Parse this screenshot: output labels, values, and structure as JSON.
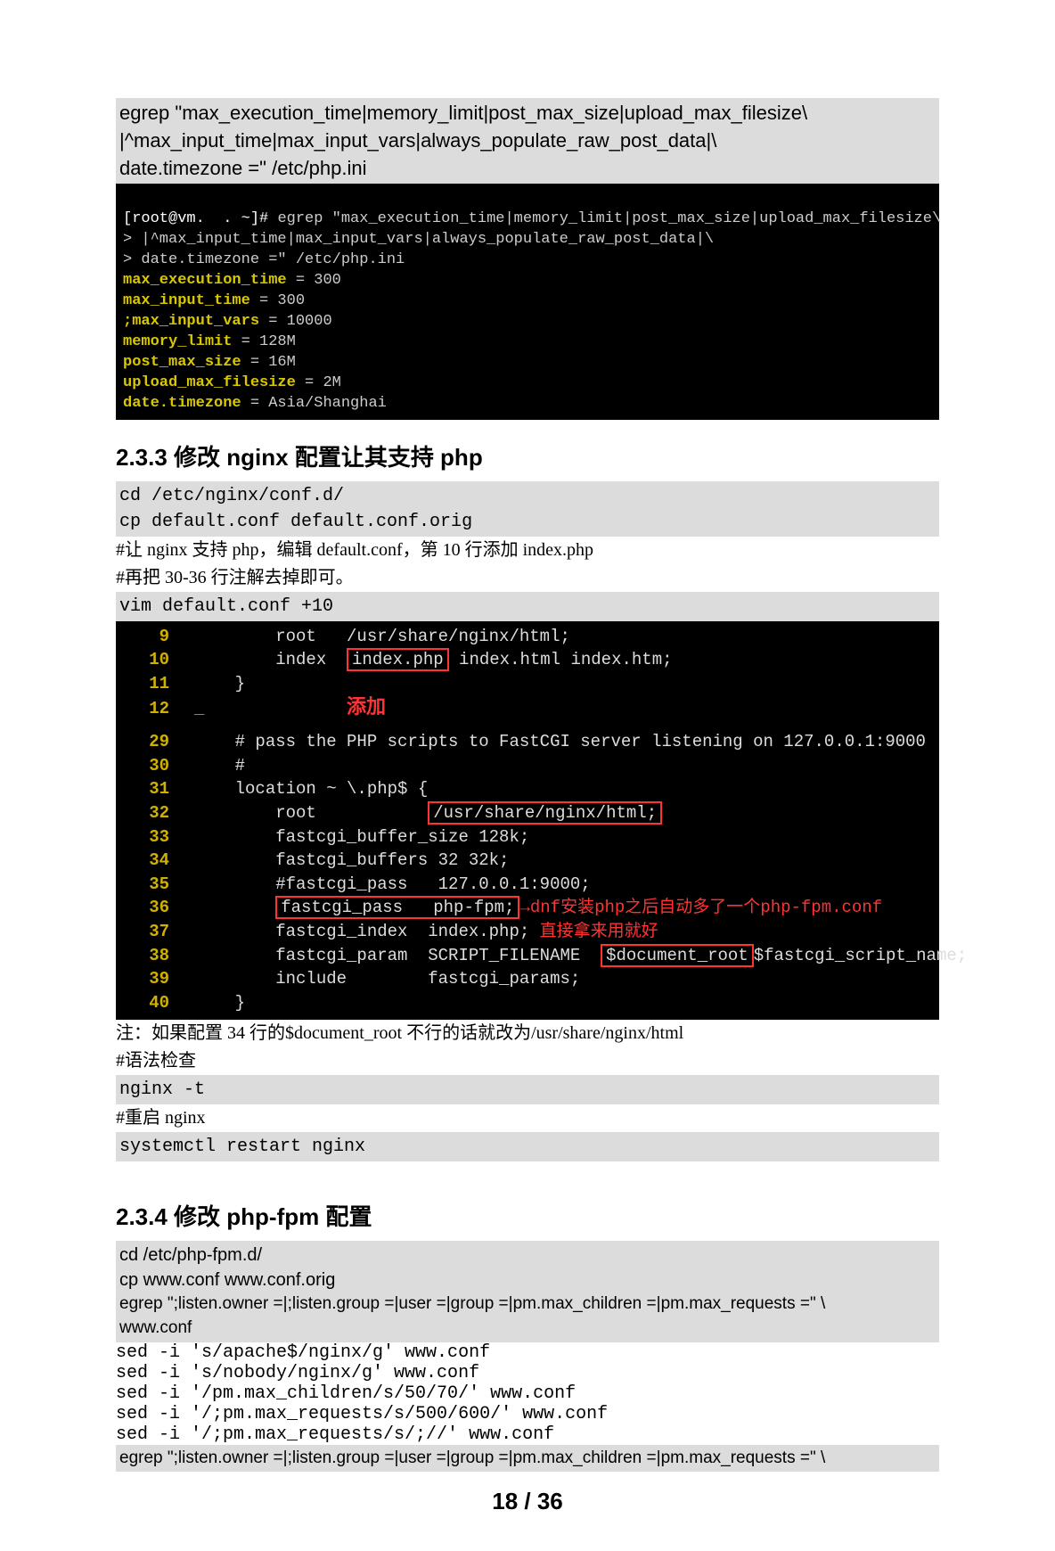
{
  "block1": {
    "l1": "egrep \"max_execution_time|memory_limit|post_max_size|upload_max_filesize\\",
    "l2": "|^max_input_time|max_input_vars|always_populate_raw_post_data|\\",
    "l3": "date.timezone =\" /etc/php.ini"
  },
  "term1": {
    "prompt": "[root@vm.  . ~]# ",
    "c1": "egrep \"max_execution_time|memory_limit|post_max_size|upload_max_filesize\\",
    "c2": "> |^max_input_time|max_input_vars|always_populate_raw_post_data|\\",
    "c3": "> date.timezone =\" /etc/php.ini",
    "o1a": "max_execution_time",
    "o1b": " = 300",
    "o2a": "max_input_time",
    "o2b": " = 300",
    "o3a": ";max_input_vars",
    "o3b": " = 10000",
    "o4a": "memory_limit",
    "o4b": " = 128M",
    "o5a": "post_max_size",
    "o5b": " = 16M",
    "o6a": "upload_max_filesize",
    "o6b": " = 2M",
    "o7a": "date.timezone",
    "o7b": " = Asia/Shanghai"
  },
  "h233": "2.3.3 修改 nginx 配置让其支持 php",
  "code233": {
    "l1": "cd /etc/nginx/conf.d/",
    "l2": "cp default.conf default.conf.orig"
  },
  "text233": {
    "l1": "#让 nginx 支持 php，编辑 default.conf，第 10 行添加 index.php",
    "l2": "#再把 30-36 行注解去掉即可。",
    "l3": "vim default.conf +10"
  },
  "term2": {
    "r9": {
      "ln": "9",
      "txt": "        root   /usr/share/nginx/html;"
    },
    "r10": {
      "ln": "10",
      "pre": "        index  ",
      "box": "index.php",
      "post": " index.html index.htm;"
    },
    "r11": {
      "ln": "11",
      "txt": "    }"
    },
    "r12": {
      "ln": "12",
      "txt": " ",
      "anno": "添加"
    },
    "gap": " ",
    "r29": {
      "ln": "29",
      "txt": "    # pass the PHP scripts to FastCGI server listening on 127.0.0.1:9000"
    },
    "r30": {
      "ln": "30",
      "txt": "    #"
    },
    "r31": {
      "ln": "31",
      "txt": "    location ~ \\.php$ {"
    },
    "r32": {
      "ln": "32",
      "pre": "        root           ",
      "box": "/usr/share/nginx/html;"
    },
    "r33": {
      "ln": "33",
      "txt": "        fastcgi_buffer_size 128k;"
    },
    "r34": {
      "ln": "34",
      "txt": "        fastcgi_buffers 32 32k;"
    },
    "r35": {
      "ln": "35",
      "txt": "        #fastcgi_pass   127.0.0.1:9000;"
    },
    "r36": {
      "ln": "36",
      "box": "fastcgi_pass   php-fpm;",
      "anno": "dnf安装php之后自动多了一个php-fpm.conf"
    },
    "r37": {
      "ln": "37",
      "txt": "        fastcgi_index  index.php; ",
      "anno": "直接拿来用就好"
    },
    "r38": {
      "ln": "38",
      "pre": "        fastcgi_param  SCRIPT_FILENAME  ",
      "box": "$document_root",
      "post": "$fastcgi_script_name;"
    },
    "r39": {
      "ln": "39",
      "txt": "        include        fastcgi_params;"
    },
    "r40": {
      "ln": "40",
      "txt": "    }"
    }
  },
  "after233": {
    "note": "注：如果配置 34 行的$document_root 不行的话就改为/usr/share/nginx/html",
    "c1": "#语法检查",
    "c2": "nginx -t",
    "c3": "#重启 nginx",
    "c4": "systemctl restart nginx"
  },
  "h234": "2.3.4 修改 php-fpm 配置",
  "block234": {
    "l1": "cd /etc/php-fpm.d/",
    "l2": "cp www.conf www.conf.orig",
    "l3": "egrep \";listen.owner =|;listen.group =|user =|group =|pm.max_children =|pm.max_requests =\"  \\",
    "l4": "www.conf",
    "l5": "sed  -i 's/apache$/nginx/g' www.conf",
    "l6": "sed -i 's/nobody/nginx/g' www.conf",
    "l7": "sed -i '/pm.max_children/s/50/70/' www.conf",
    "l8": "sed -i '/;pm.max_requests/s/500/600/' www.conf",
    "l9": "sed -i '/;pm.max_requests/s/;//' www.conf",
    "l10": "egrep \";listen.owner =|;listen.group =|user =|group =|pm.max_children =|pm.max_requests =\"  \\"
  },
  "pagenum": "18 / 36"
}
